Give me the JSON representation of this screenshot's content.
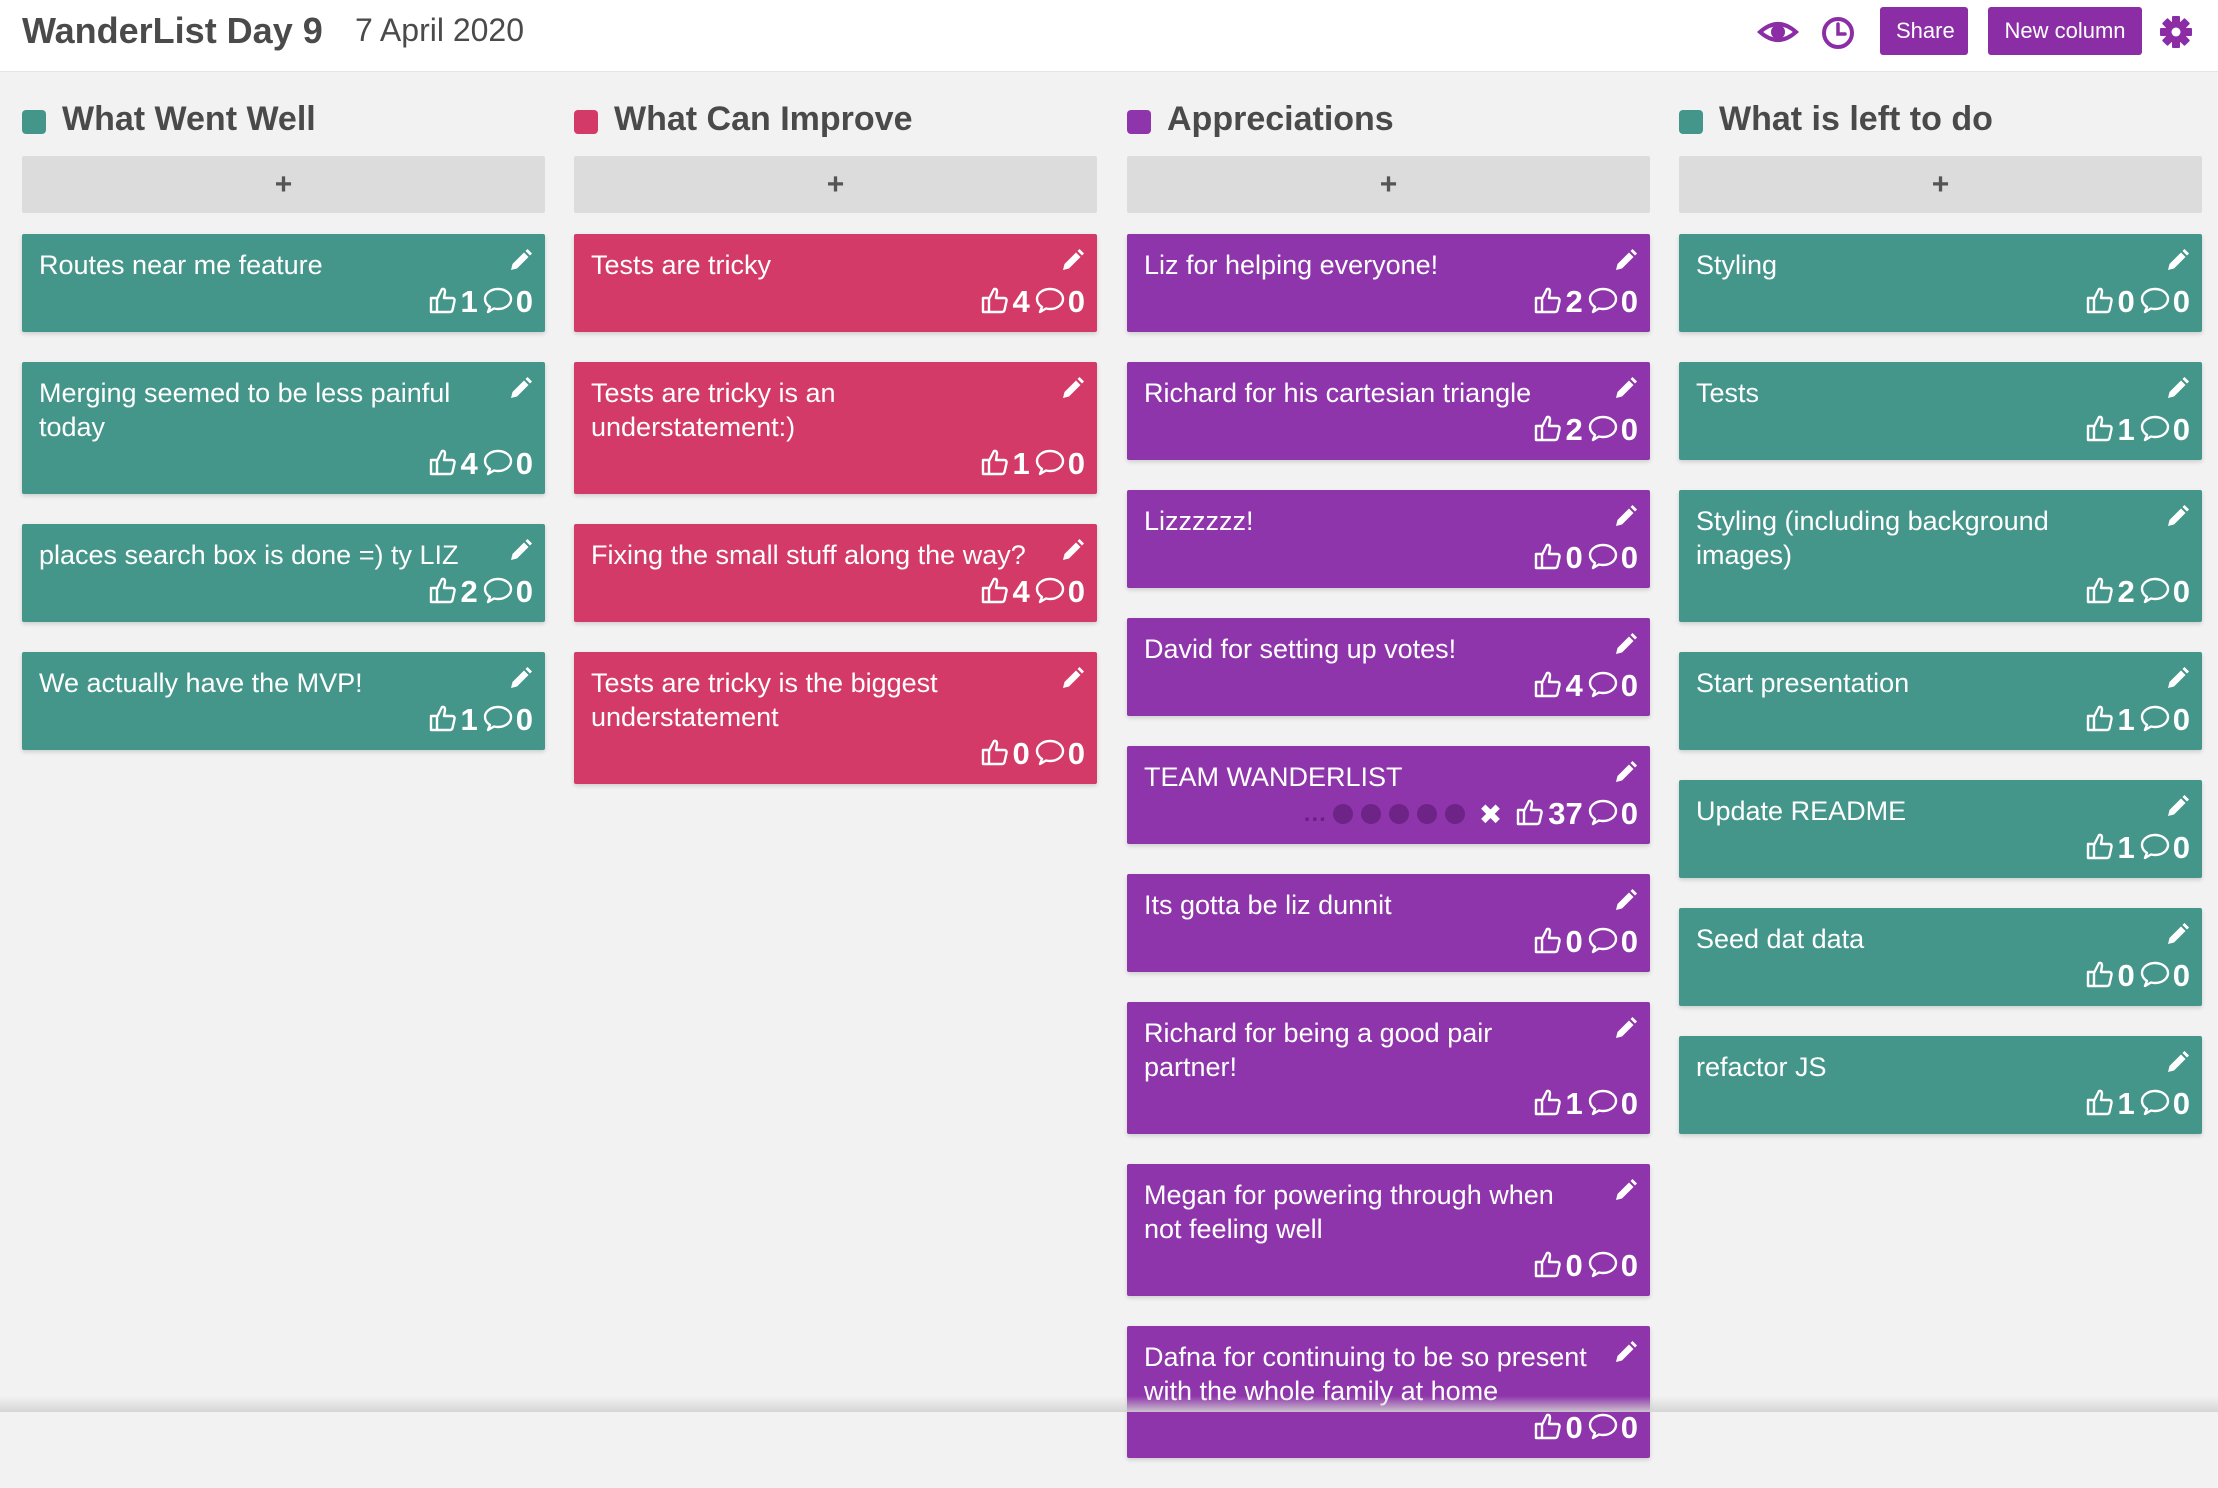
{
  "header": {
    "title": "WanderList Day 9",
    "date": "7 April 2020",
    "share_label": "Share",
    "new_column_label": "New column",
    "icons": [
      "eye-icon",
      "clock-icon",
      "gear-icon"
    ],
    "accent_color": "#8b2ea6"
  },
  "add_label": "+",
  "columns": [
    {
      "title": "What Went Well",
      "color": "#45968a",
      "cards": [
        {
          "text": "Routes near me feature",
          "votes": "1",
          "comments": "0"
        },
        {
          "text": "Merging seemed to be less painful today",
          "votes": "4",
          "comments": "0"
        },
        {
          "text": "places search box is done =) ty LIZ",
          "votes": "2",
          "comments": "0"
        },
        {
          "text": "We actually have the MVP!",
          "votes": "1",
          "comments": "0"
        }
      ]
    },
    {
      "title": "What Can Improve",
      "color": "#d43a67",
      "cards": [
        {
          "text": "Tests are tricky",
          "votes": "4",
          "comments": "0"
        },
        {
          "text": "Tests are tricky is an understatement:)",
          "votes": "1",
          "comments": "0"
        },
        {
          "text": "Fixing the small stuff along the way?",
          "votes": "4",
          "comments": "0"
        },
        {
          "text": "Tests are tricky is the biggest understatement",
          "votes": "0",
          "comments": "0"
        }
      ]
    },
    {
      "title": "Appreciations",
      "color": "#8f35ab",
      "cards": [
        {
          "text": "Liz for helping everyone!",
          "votes": "2",
          "comments": "0"
        },
        {
          "text": "Richard for his cartesian triangle",
          "votes": "2",
          "comments": "0"
        },
        {
          "text": "Lizzzzzz!",
          "votes": "0",
          "comments": "0"
        },
        {
          "text": "David for setting up votes!",
          "votes": "4",
          "comments": "0"
        },
        {
          "text": "TEAM WANDERLIST",
          "votes": "37",
          "comments": "0",
          "dots": "...",
          "dot_count": 5,
          "clear": "✖"
        },
        {
          "text": "Its gotta be liz dunnit",
          "votes": "0",
          "comments": "0"
        },
        {
          "text": "Richard for being a good pair partner!",
          "votes": "1",
          "comments": "0"
        },
        {
          "text": "Megan for powering through when not feeling well",
          "votes": "0",
          "comments": "0"
        },
        {
          "text": "Dafna for continuing to be so present with the whole family at home",
          "votes": "0",
          "comments": "0"
        }
      ]
    },
    {
      "title": "What is left to do",
      "color": "#45968a",
      "cards": [
        {
          "text": "Styling",
          "votes": "0",
          "comments": "0"
        },
        {
          "text": "Tests",
          "votes": "1",
          "comments": "0"
        },
        {
          "text": "Styling (including background images)",
          "votes": "2",
          "comments": "0"
        },
        {
          "text": "Start presentation",
          "votes": "1",
          "comments": "0"
        },
        {
          "text": "Update README",
          "votes": "1",
          "comments": "0"
        },
        {
          "text": "Seed dat data",
          "votes": "0",
          "comments": "0"
        },
        {
          "text": "refactor JS",
          "votes": "1",
          "comments": "0"
        }
      ]
    }
  ]
}
